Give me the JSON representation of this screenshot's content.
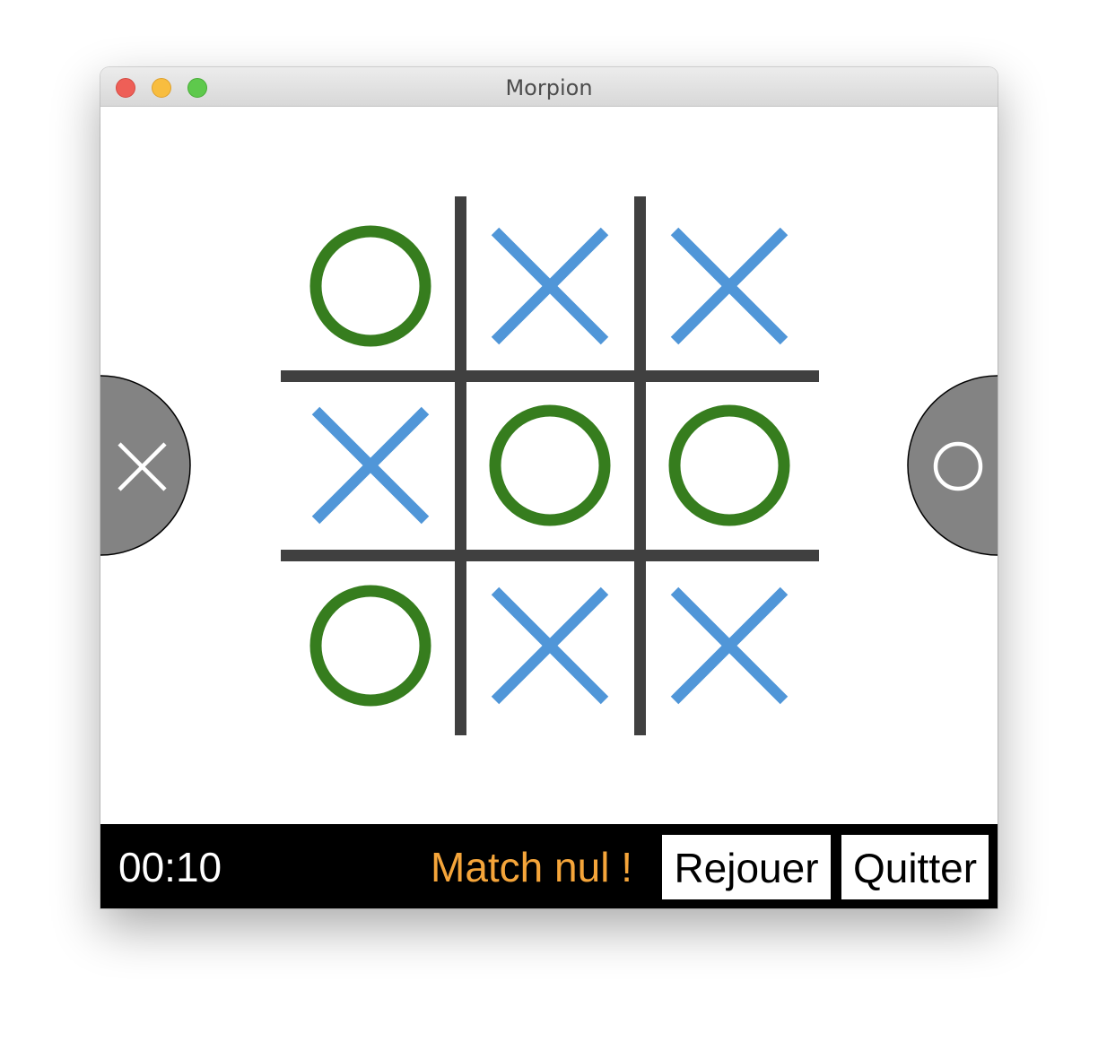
{
  "window": {
    "title": "Morpion"
  },
  "colors": {
    "x_mark": "#5096d8",
    "o_mark": "#367d1e",
    "grid_line": "#404040",
    "side_badge": "#838383",
    "status_text": "#f5a53a"
  },
  "players": {
    "left": {
      "symbol": "X",
      "icon": "x-icon"
    },
    "right": {
      "symbol": "O",
      "icon": "o-icon"
    }
  },
  "board": {
    "cells": [
      [
        "O",
        "X",
        "X"
      ],
      [
        "X",
        "O",
        "O"
      ],
      [
        "O",
        "X",
        "X"
      ]
    ]
  },
  "footer": {
    "timer": "00:10",
    "status": "Match nul !",
    "replay_label": "Rejouer",
    "quit_label": "Quitter"
  }
}
